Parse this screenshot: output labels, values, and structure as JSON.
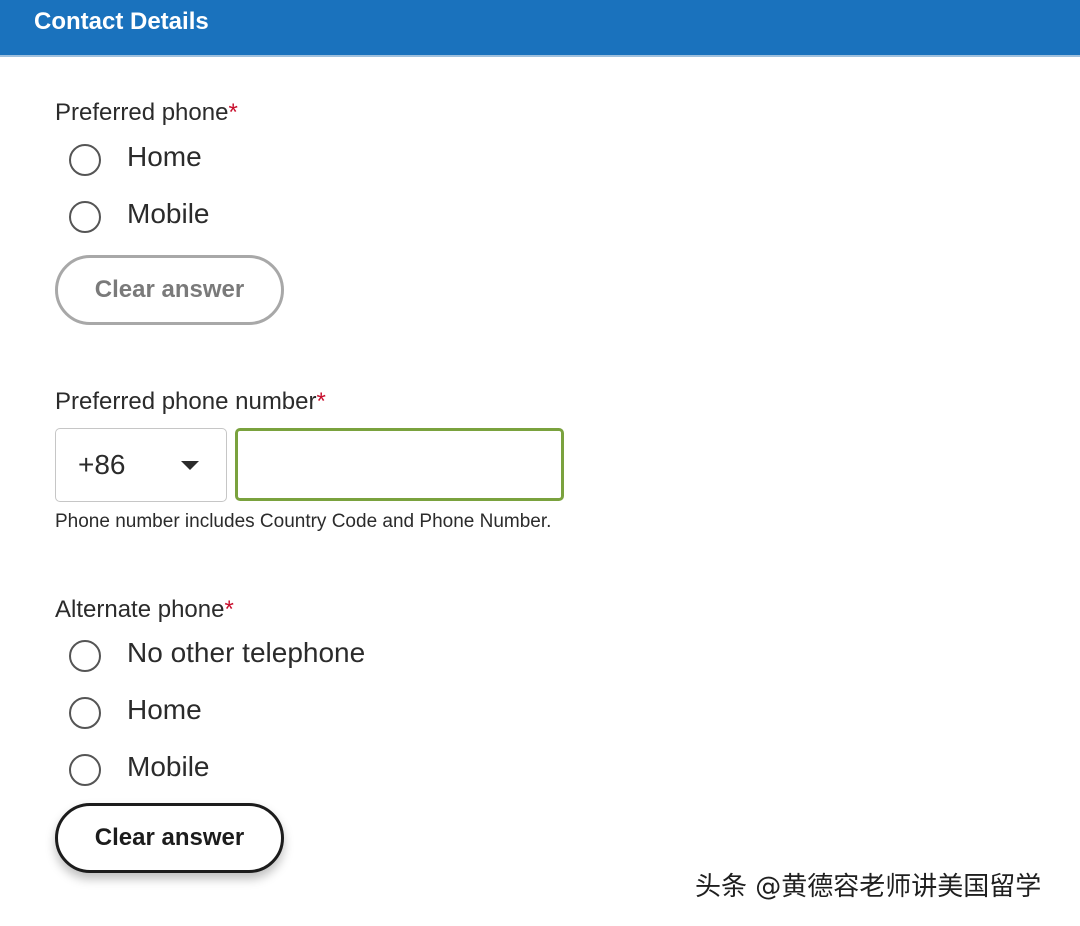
{
  "header": {
    "title": "Contact Details"
  },
  "preferred_phone": {
    "label": "Preferred phone",
    "required_mark": "*",
    "options": [
      {
        "label": "Home",
        "selected": false
      },
      {
        "label": "Mobile",
        "selected": false
      }
    ],
    "clear_label": "Clear answer"
  },
  "preferred_number": {
    "label": "Preferred phone number",
    "required_mark": "*",
    "country_code": "+86",
    "value": "",
    "helper": "Phone number includes Country Code and Phone Number."
  },
  "alternate_phone": {
    "label": "Alternate phone",
    "required_mark": "*",
    "options": [
      {
        "label": "No other telephone",
        "selected": false
      },
      {
        "label": "Home",
        "selected": false
      },
      {
        "label": "Mobile",
        "selected": false
      }
    ],
    "clear_label": "Clear answer"
  },
  "watermark": {
    "text": "头条 @黄德容老师讲美国留学"
  },
  "colors": {
    "header_bg": "#1a72bd",
    "required": "#c8102e",
    "input_focus_border": "#7aa23e"
  }
}
